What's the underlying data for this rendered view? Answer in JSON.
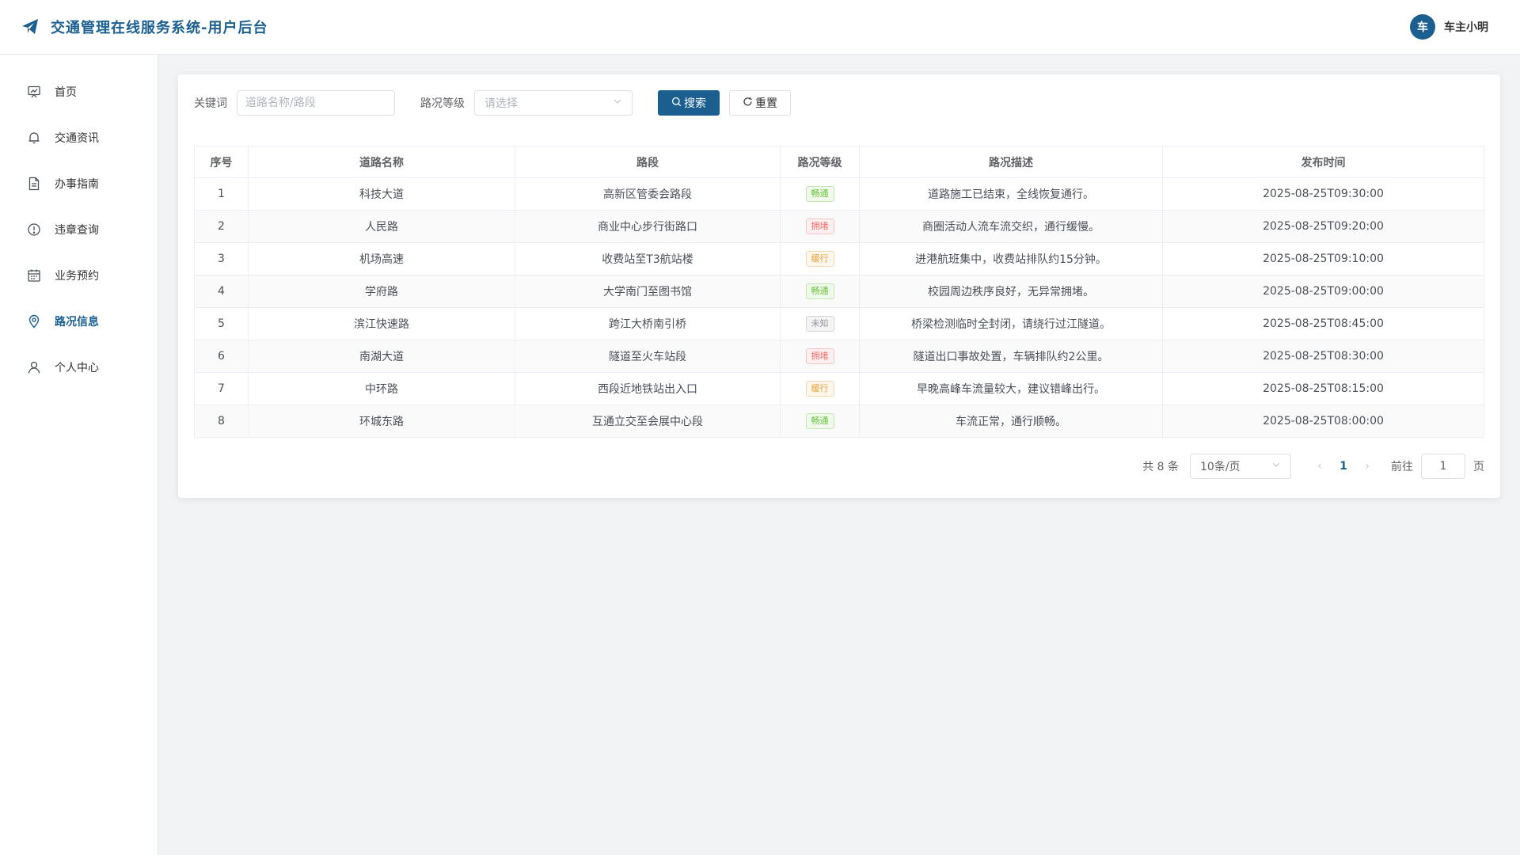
{
  "header": {
    "title": "交通管理在线服务系统-用户后台",
    "avatar_text": "车",
    "user_name": "车主小明"
  },
  "sidebar": {
    "items": [
      {
        "label": "首页",
        "icon": "dashboard-icon"
      },
      {
        "label": "交通资讯",
        "icon": "bell-icon"
      },
      {
        "label": "办事指南",
        "icon": "document-icon"
      },
      {
        "label": "违章查询",
        "icon": "warning-icon"
      },
      {
        "label": "业务预约",
        "icon": "calendar-icon"
      },
      {
        "label": "路况信息",
        "icon": "location-icon",
        "active": true
      },
      {
        "label": "个人中心",
        "icon": "user-icon"
      }
    ]
  },
  "filters": {
    "keyword_label": "关键词",
    "keyword_placeholder": "道路名称/路段",
    "level_label": "路况等级",
    "level_placeholder": "请选择",
    "search_label": "搜索",
    "reset_label": "重置"
  },
  "table": {
    "columns": [
      "序号",
      "道路名称",
      "路段",
      "路况等级",
      "路况描述",
      "发布时间"
    ],
    "rows": [
      {
        "no": "1",
        "road": "科技大道",
        "section": "高新区管委会路段",
        "level": "畅通",
        "desc": "道路施工已结束，全线恢复通行。",
        "time": "2025-08-25T09:30:00"
      },
      {
        "no": "2",
        "road": "人民路",
        "section": "商业中心步行街路口",
        "level": "拥堵",
        "desc": "商圈活动人流车流交织，通行缓慢。",
        "time": "2025-08-25T09:20:00"
      },
      {
        "no": "3",
        "road": "机场高速",
        "section": "收费站至T3航站楼",
        "level": "缓行",
        "desc": "进港航班集中，收费站排队约15分钟。",
        "time": "2025-08-25T09:10:00"
      },
      {
        "no": "4",
        "road": "学府路",
        "section": "大学南门至图书馆",
        "level": "畅通",
        "desc": "校园周边秩序良好，无异常拥堵。",
        "time": "2025-08-25T09:00:00"
      },
      {
        "no": "5",
        "road": "滨江快速路",
        "section": "跨江大桥南引桥",
        "level": "未知",
        "desc": "桥梁检测临时全封闭，请绕行过江隧道。",
        "time": "2025-08-25T08:45:00"
      },
      {
        "no": "6",
        "road": "南湖大道",
        "section": "隧道至火车站段",
        "level": "拥堵",
        "desc": "隧道出口事故处置，车辆排队约2公里。",
        "time": "2025-08-25T08:30:00"
      },
      {
        "no": "7",
        "road": "中环路",
        "section": "西段近地铁站出入口",
        "level": "缓行",
        "desc": "早晚高峰车流量较大，建议错峰出行。",
        "time": "2025-08-25T08:15:00"
      },
      {
        "no": "8",
        "road": "环城东路",
        "section": "互通立交至会展中心段",
        "level": "畅通",
        "desc": "车流正常，通行顺畅。",
        "time": "2025-08-25T08:00:00"
      }
    ]
  },
  "level_colors": {
    "畅通": {
      "text": "#67c23a",
      "bg": "#f0f9eb",
      "border": "#c2e7b0"
    },
    "拥堵": {
      "text": "#f56c6c",
      "bg": "#fef0f0",
      "border": "#fbc4c4"
    },
    "缓行": {
      "text": "#e6a23c",
      "bg": "#fdf6ec",
      "border": "#f5dab1"
    },
    "未知": {
      "text": "#909399",
      "bg": "#f4f4f5",
      "border": "#d3d4d6"
    }
  },
  "pagination": {
    "total_text": "共 8 条",
    "page_size": "10条/页",
    "current_page": "1",
    "goto_prefix": "前往",
    "goto_value": "1",
    "goto_suffix": "页"
  },
  "accent_color": "#1a5f8f"
}
